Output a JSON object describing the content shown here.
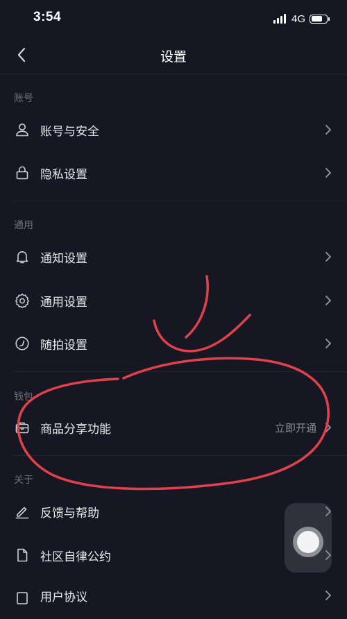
{
  "status_bar": {
    "time": "3:54",
    "network": "4G"
  },
  "nav": {
    "title": "设置",
    "back_icon": "chevron-left-icon"
  },
  "sections": {
    "account": {
      "header": "账号",
      "items": [
        {
          "label": "账号与安全",
          "icon": "user-icon"
        },
        {
          "label": "隐私设置",
          "icon": "lock-icon"
        }
      ]
    },
    "general": {
      "header": "通用",
      "items": [
        {
          "label": "通知设置",
          "icon": "bell-icon"
        },
        {
          "label": "通用设置",
          "icon": "gear-icon"
        },
        {
          "label": "随拍设置",
          "icon": "camera-circle-icon"
        }
      ]
    },
    "wallet": {
      "header": "钱包",
      "items": [
        {
          "label": "商品分享功能",
          "icon": "briefcase-icon",
          "value": "立即开通"
        }
      ]
    },
    "about": {
      "header": "关于",
      "items": [
        {
          "label": "反馈与帮助",
          "icon": "edit-icon"
        },
        {
          "label": "社区自律公约",
          "icon": "document-icon"
        },
        {
          "label": "用户协议",
          "icon": "square-icon"
        }
      ]
    }
  },
  "colors": {
    "background": "#161722",
    "text_primary": "#e8e8ea",
    "text_secondary": "#6f717b",
    "annotation": "#e0424b"
  }
}
